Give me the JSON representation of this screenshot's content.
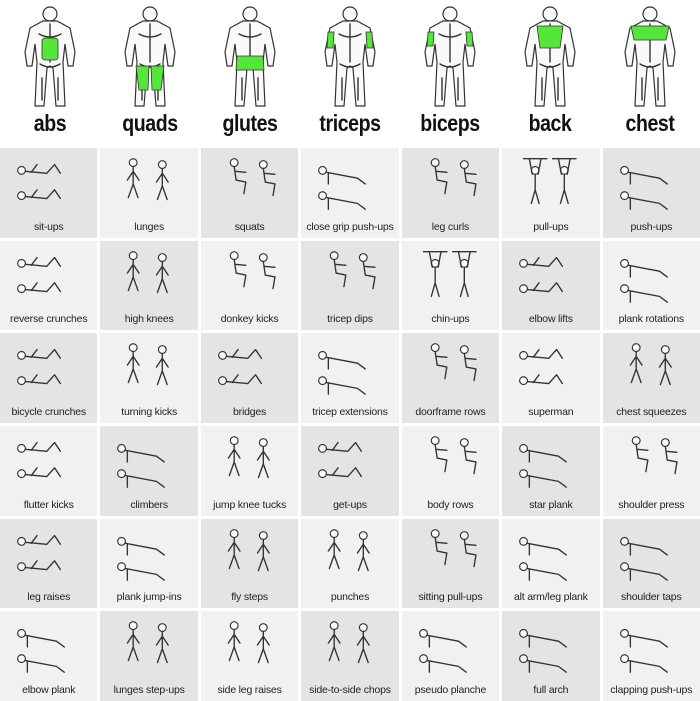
{
  "colors": {
    "muscle_highlight": "#55e63a",
    "cell_dark": "#e4e4e4",
    "cell_light": "#f1f1f1"
  },
  "header": [
    {
      "title": "abs",
      "view": "front",
      "highlight": "abs"
    },
    {
      "title": "quads",
      "view": "front",
      "highlight": "quads"
    },
    {
      "title": "glutes",
      "view": "back",
      "highlight": "glutes"
    },
    {
      "title": "triceps",
      "view": "back",
      "highlight": "triceps"
    },
    {
      "title": "biceps",
      "view": "front",
      "highlight": "biceps"
    },
    {
      "title": "back",
      "view": "back",
      "highlight": "back"
    },
    {
      "title": "chest",
      "view": "front",
      "highlight": "chest"
    }
  ],
  "rows": [
    [
      "sit-ups",
      "lunges",
      "squats",
      "close grip push-ups",
      "leg curls",
      "pull-ups",
      "push-ups"
    ],
    [
      "reverse crunches",
      "high knees",
      "donkey kicks",
      "tricep dips",
      "chin-ups",
      "elbow lifts",
      "plank rotations"
    ],
    [
      "bicycle crunches",
      "turning kicks",
      "bridges",
      "tricep extensions",
      "doorframe rows",
      "superman",
      "chest squeezes"
    ],
    [
      "flutter kicks",
      "climbers",
      "jump knee tucks",
      "get-ups",
      "body rows",
      "star plank",
      "shoulder press"
    ],
    [
      "leg raises",
      "plank jump-ins",
      "fly steps",
      "punches",
      "sitting pull-ups",
      "alt arm/leg plank",
      "shoulder taps"
    ],
    [
      "elbow plank",
      "lunges step-ups",
      "side leg raises",
      "side-to-side chops",
      "pseudo planche",
      "full arch",
      "clapping push-ups"
    ]
  ]
}
